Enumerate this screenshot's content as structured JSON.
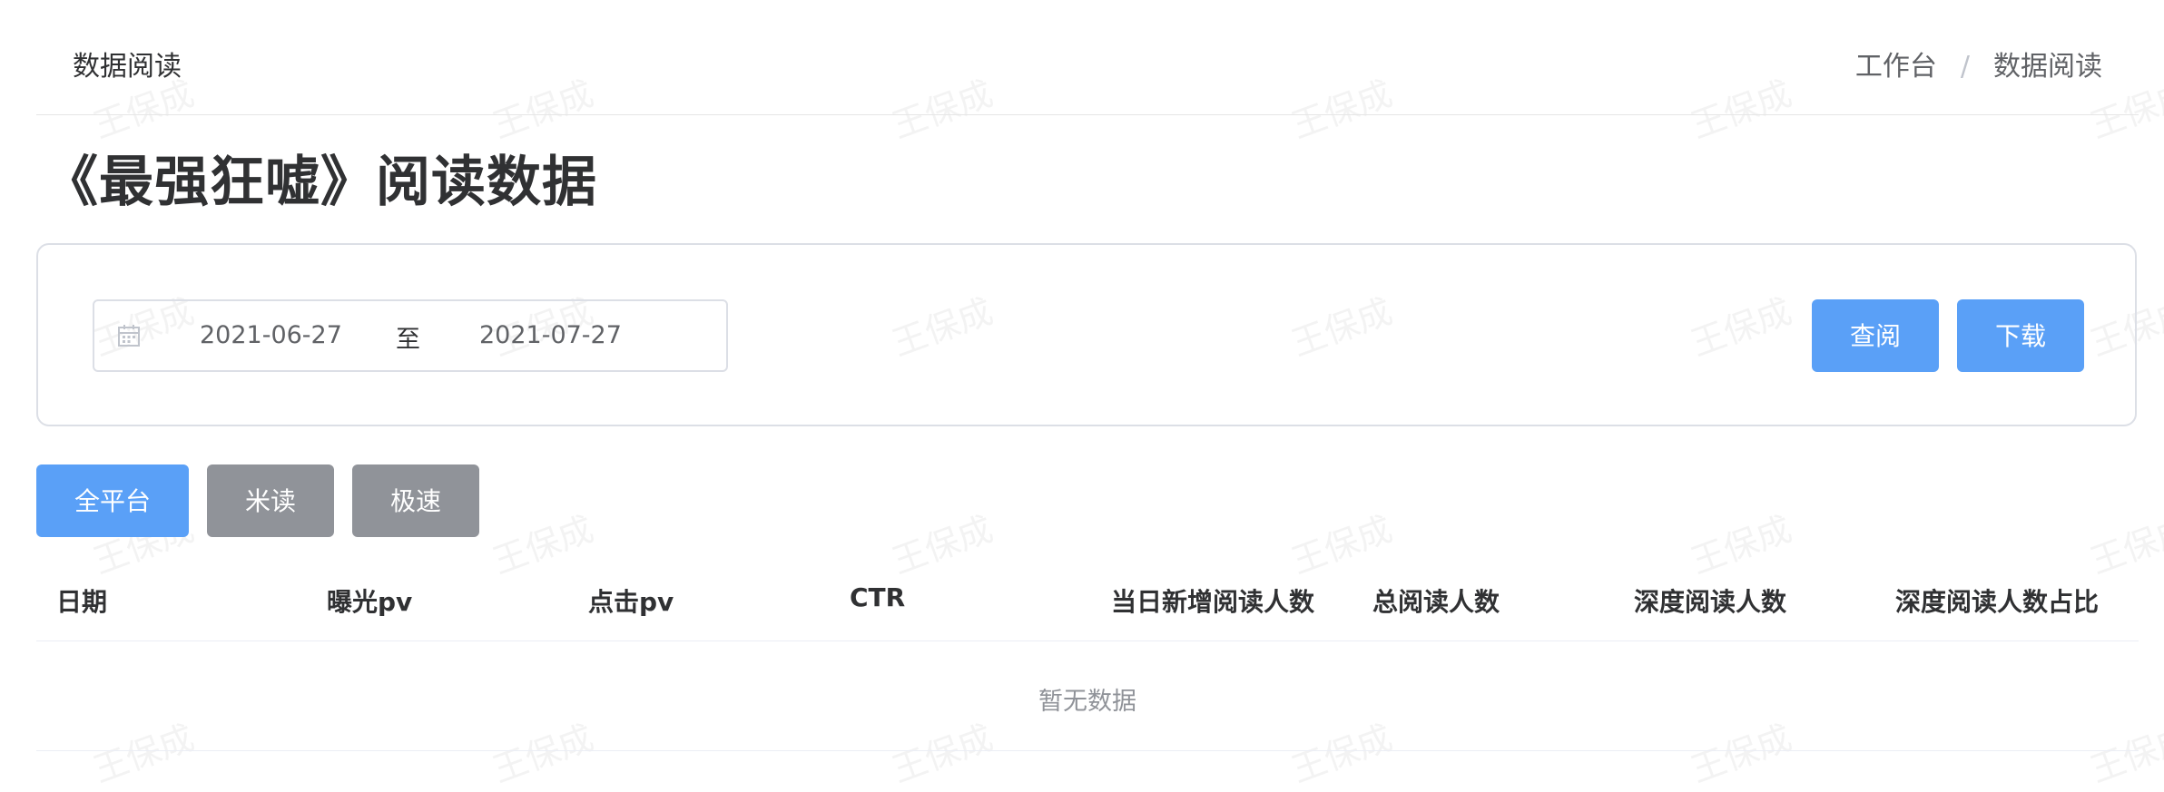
{
  "header": {
    "page_name": "数据阅读",
    "breadcrumb": {
      "home": "工作台",
      "separator": "/",
      "current": "数据阅读"
    }
  },
  "title": "《最强狂嘘》阅读数据",
  "filter": {
    "start_date": "2021-06-27",
    "range_separator": "至",
    "end_date": "2021-07-27",
    "calendar_icon": "calendar-icon",
    "query_label": "查阅",
    "download_label": "下载"
  },
  "platform_tabs": [
    {
      "label": "全平台",
      "active": true
    },
    {
      "label": "米读",
      "active": false
    },
    {
      "label": "极速",
      "active": false
    }
  ],
  "table": {
    "columns": [
      "日期",
      "曝光pv",
      "点击pv",
      "CTR",
      "当日新增阅读人数",
      "总阅读人数",
      "深度阅读人数",
      "深度阅读人数占比"
    ],
    "empty_text": "暂无数据"
  },
  "watermark": "王保成",
  "colors": {
    "primary": "#5aa0f7",
    "gray_button": "#909399",
    "text": "#303133"
  }
}
